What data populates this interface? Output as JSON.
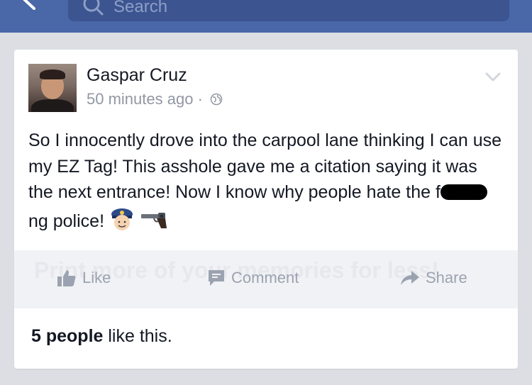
{
  "header": {
    "back_icon": "chevron-left-icon",
    "search_placeholder": "Search"
  },
  "post": {
    "author": "Gaspar Cruz",
    "time": "50 minutes ago",
    "separator": "·",
    "privacy_icon": "globe-icon",
    "text_before_redaction": "So I innocently drove into the carpool lane thinking I can use my EZ Tag! This asshole gave me a citation saying it was the next entrance! Now I know why people hate the f",
    "text_after_redaction": "ng police!",
    "emojis": [
      "police-officer-emoji",
      "pistol-emoji"
    ]
  },
  "actions": {
    "like_label": "Like",
    "comment_label": "Comment",
    "share_label": "Share",
    "watermark": "Print more of your memories for less!"
  },
  "likes": {
    "count_text": "5 people",
    "suffix": "like this."
  }
}
